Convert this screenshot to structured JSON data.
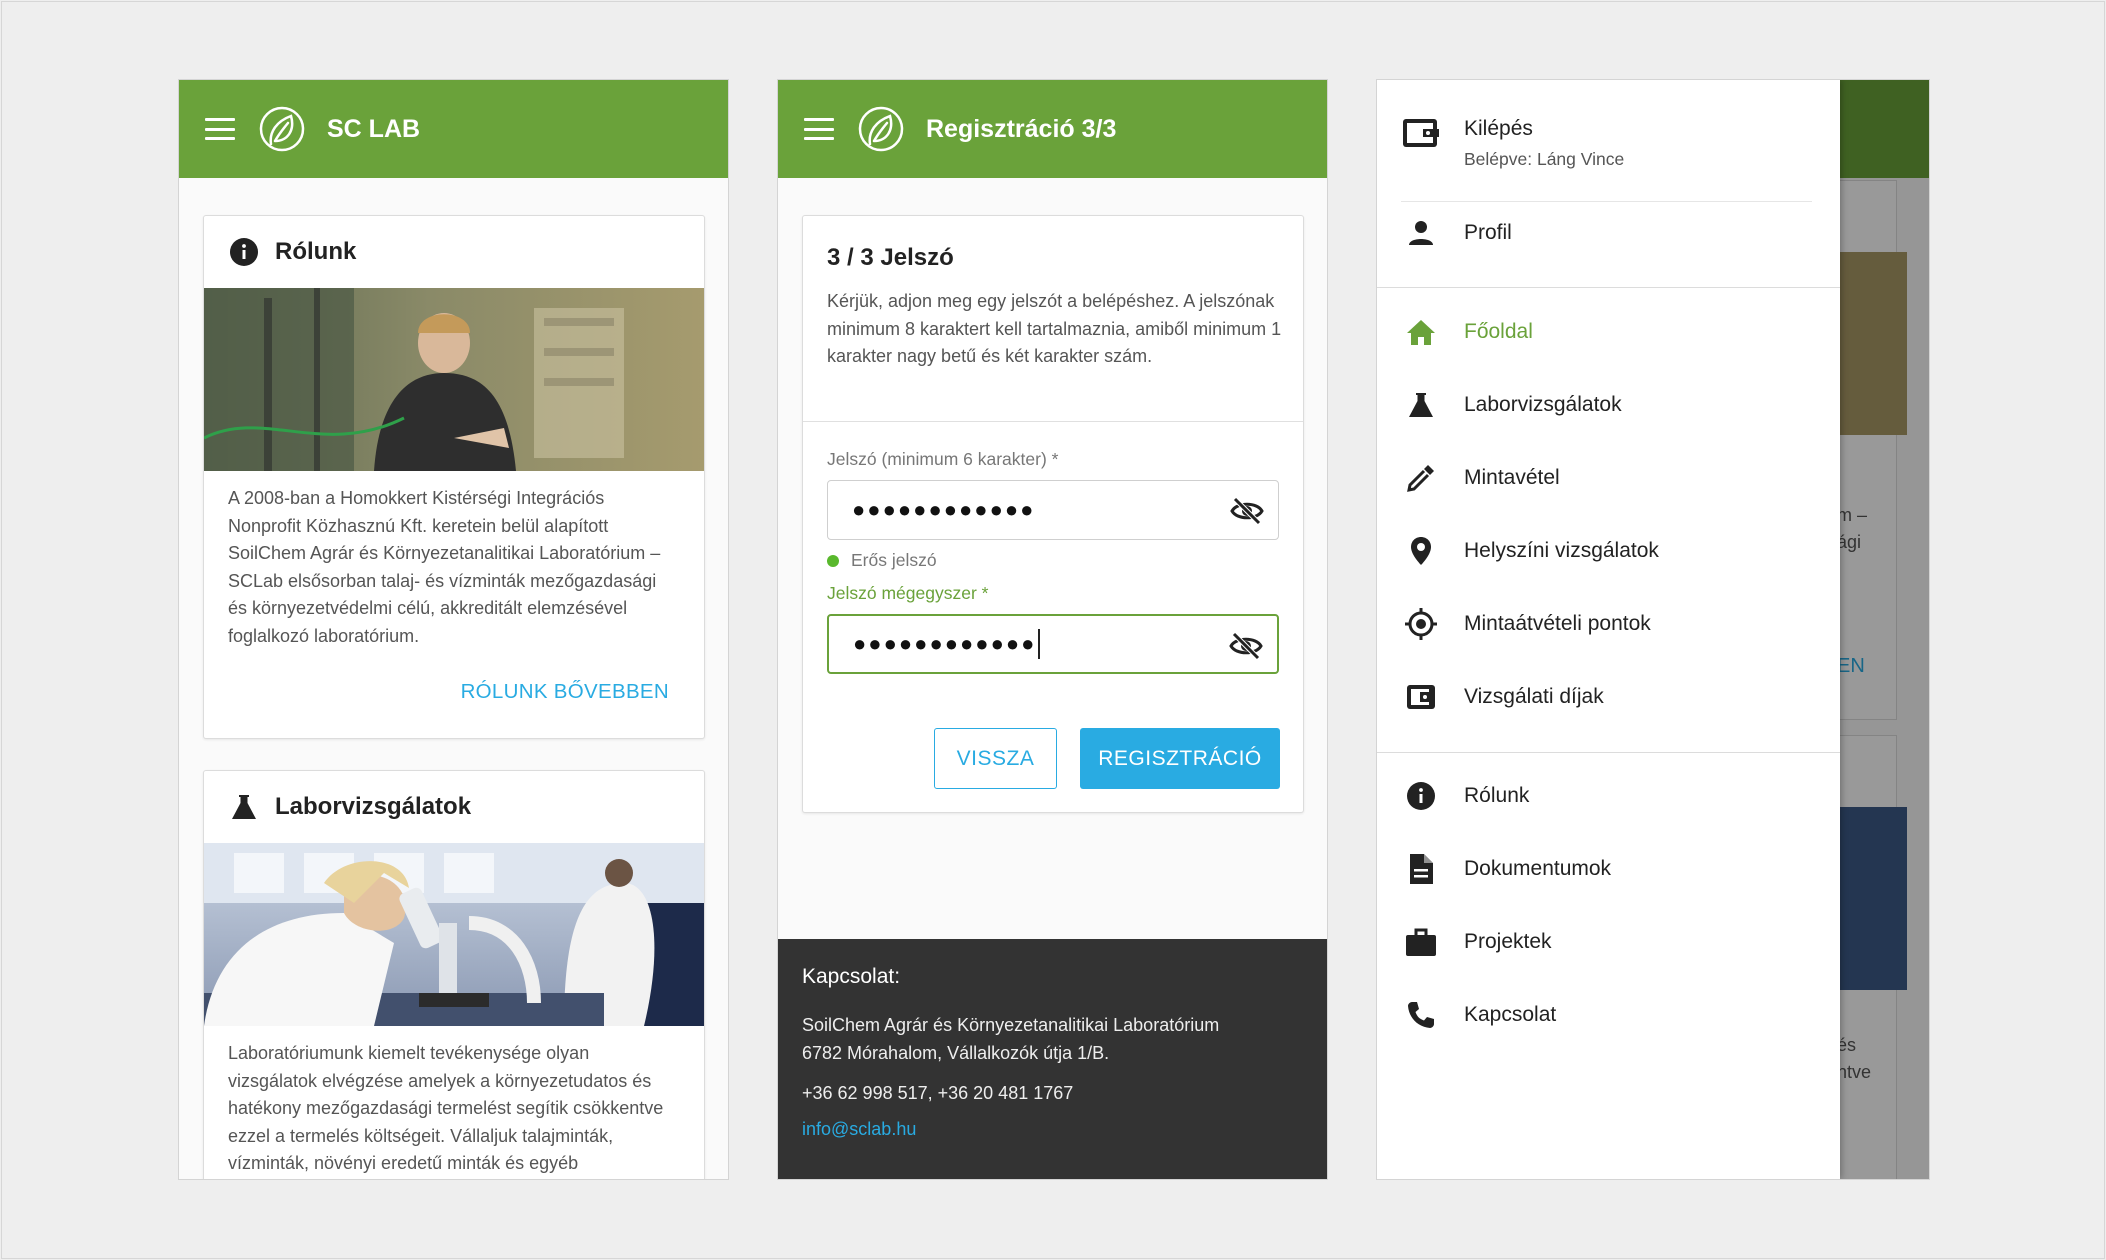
{
  "screen1": {
    "appbar_title": "SC LAB",
    "cards": [
      {
        "title": "Rólunk",
        "text": "A 2008-ban a Homokkert Kistérségi Integrációs Nonprofit Közhasznú Kft. keretein belül alapított SoilChem Agrár és Környezetanalitikai Laboratórium – SCLab elsősorban talaj- és vízminták mezőgazdasági és környezetvédelmi célú, akkreditált elemzésével foglalkozó laboratórium.",
        "action": "RÓLUNK BŐVEBBEN"
      },
      {
        "title": "Laborvizsgálatok",
        "text": "Laboratóriumunk kiemelt tevékenysége olyan vizsgálatok elvégzése amelyek a környezetudatos és hatékony mezőgazdasági termelést segítik csökkentve ezzel a termelés költségeit. Vállaljuk talajminták, vízminták, növényi eredetű minták és egyéb"
      }
    ]
  },
  "screen2": {
    "appbar_title": "Regisztráció 3/3",
    "form_title": "3 / 3 Jelszó",
    "intro": "Kérjük, adjon meg egy jelszót a belépéshez. A jelszónak minimum 8 karaktert kell tartalmaznia, amiből minimum 1 karakter nagy betű és két karakter szám.",
    "password_label": "Jelszó (minimum 6 karakter) *",
    "password_value": "●●●●●●●●●●●●",
    "strength_text": "Erős jelszó",
    "confirm_label": "Jelszó mégegyszer *",
    "confirm_value": "●●●●●●●●●●●●",
    "back_button": "VISSZA",
    "submit_button": "REGISZTRÁCIÓ",
    "footer": {
      "heading": "Kapcsolat:",
      "address_line1": "SoilChem Agrár és Környezetanalitikai Laboratórium",
      "address_line2": "6782 Mórahalom, Vállalkozók útja 1/B.",
      "phones": "+36 62 998 517, +36 20 481 1767",
      "email": "info@sclab.hu"
    }
  },
  "screen3": {
    "logout_title": "Kilépés",
    "logged_in_as": "Belépve: Láng Vince",
    "profile": "Profil",
    "main_items": [
      {
        "label": "Főoldal",
        "icon": "home-icon",
        "active": true
      },
      {
        "label": "Laborvizsgálatok",
        "icon": "flask-icon"
      },
      {
        "label": "Mintavétel",
        "icon": "pipette-icon"
      },
      {
        "label": "Helyszíni vizsgálatok",
        "icon": "map-pin-icon"
      },
      {
        "label": "Mintaátvételi pontok",
        "icon": "target-icon"
      },
      {
        "label": "Vizsgálati díjak",
        "icon": "wallet-icon"
      }
    ],
    "secondary_items": [
      {
        "label": "Rólunk",
        "icon": "info-icon"
      },
      {
        "label": "Dokumentumok",
        "icon": "document-icon"
      },
      {
        "label": "Projektek",
        "icon": "briefcase-icon"
      },
      {
        "label": "Kapcsolat",
        "icon": "phone-icon"
      }
    ],
    "behind_fragments": [
      "m –",
      "ági",
      "EN",
      "és",
      "ntve"
    ]
  },
  "colors": {
    "brand_green": "#6aa23a",
    "accent_blue": "#29abe2",
    "footer_dark": "#333333",
    "strength_green": "#59b82d"
  }
}
